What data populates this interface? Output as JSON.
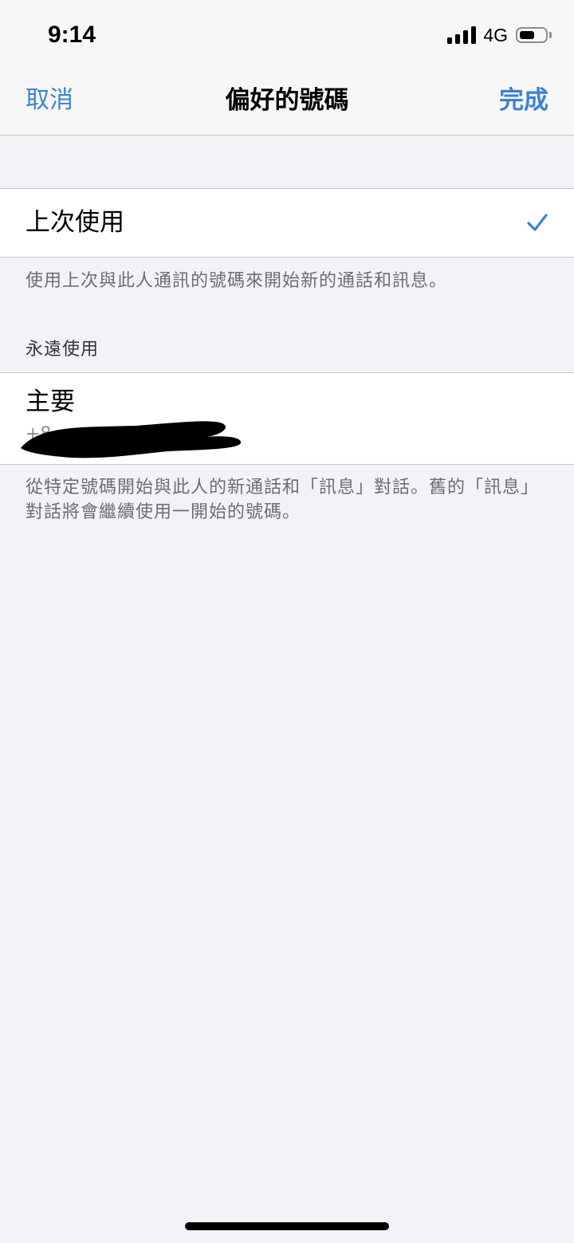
{
  "status_bar": {
    "time": "9:14",
    "network": "4G",
    "signal_bars": 4,
    "battery_level": 0.6
  },
  "nav": {
    "cancel_label": "取消",
    "title": "偏好的號碼",
    "done_label": "完成"
  },
  "last_used": {
    "label": "上次使用",
    "selected": true,
    "icon": "checkmark-icon",
    "footer": "使用上次與此人通訊的號碼來開始新的通話和訊息。"
  },
  "always_use": {
    "header": "永遠使用",
    "primary_label": "主要",
    "primary_number_visible": "+8",
    "footer": "從特定號碼開始與此人的新通話和「訊息」對話。舊的「訊息」對話將會繼續使用一開始的號碼。"
  },
  "colors": {
    "accent": "#3b82d6",
    "background": "#f2f2f7",
    "cell_background": "#ffffff",
    "secondary_text": "#6d6d72"
  }
}
